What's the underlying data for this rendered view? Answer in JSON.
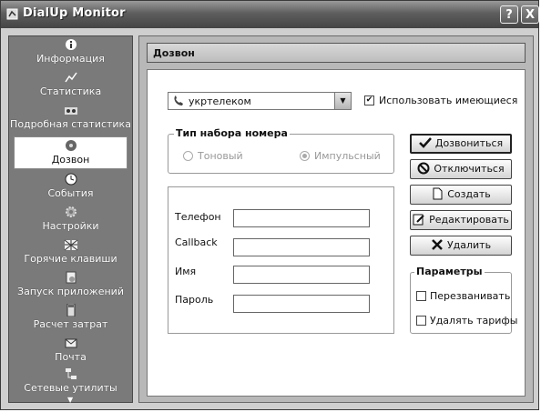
{
  "window": {
    "title": "DialUp Monitor",
    "help_btn": "?",
    "close_btn": "X"
  },
  "sidebar": {
    "items": [
      {
        "label": "Информация",
        "icon": "info-icon"
      },
      {
        "label": "Статистика",
        "icon": "chart-icon"
      },
      {
        "label": "Подробная статистика",
        "icon": "detailed-stats-icon"
      },
      {
        "label": "Дозвон",
        "icon": "dial-icon",
        "active": true
      },
      {
        "label": "События",
        "icon": "clock-icon"
      },
      {
        "label": "Настройки",
        "icon": "gear-icon"
      },
      {
        "label": "Горячие клавиши",
        "icon": "keyboard-icon"
      },
      {
        "label": "Запуск приложений",
        "icon": "app-launch-icon"
      },
      {
        "label": "Расчет затрат",
        "icon": "calculator-icon"
      },
      {
        "label": "Почта",
        "icon": "mail-icon"
      },
      {
        "label": "Сетевые утилиты",
        "icon": "network-icon"
      }
    ]
  },
  "main": {
    "header": "Дозвон",
    "connection": "укртелеком",
    "use_existing_label": "Использовать имеющиеся",
    "use_existing_checked": true,
    "dial_type": {
      "title": "Тип набора номера",
      "tone": "Тоновый",
      "pulse": "Импульсный",
      "selected": "pulse"
    },
    "fields": {
      "phone": {
        "label": "Телефон",
        "value": ""
      },
      "callback": {
        "label": "Callback",
        "value": ""
      },
      "name": {
        "label": "Имя",
        "value": ""
      },
      "password": {
        "label": "Пароль",
        "value": ""
      }
    },
    "buttons": {
      "dial": "Дозвониться",
      "disconnect": "Отключиться",
      "create": "Создать",
      "edit": "Редактировать",
      "delete": "Удалить"
    },
    "params": {
      "title": "Параметры",
      "redial": "Перезванивать",
      "redial_checked": false,
      "delete_tariffs": "Удалять тарифы",
      "delete_tariffs_checked": false
    }
  }
}
